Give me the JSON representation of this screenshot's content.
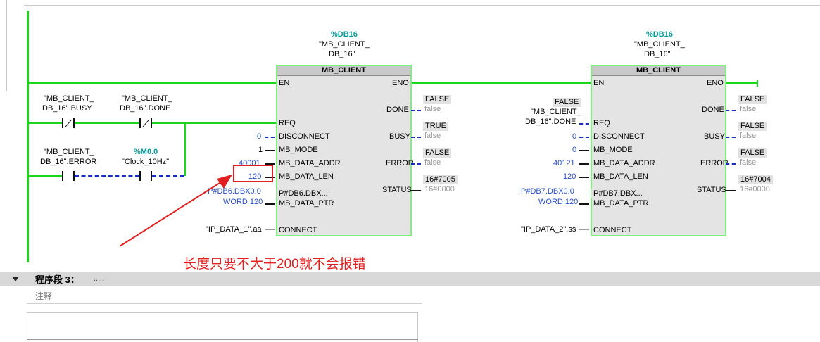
{
  "network": {
    "contacts": {
      "busy_tag": [
        "\"MB_CLIENT_",
        "DB_16\".BUSY"
      ],
      "done_tag": [
        "\"MB_CLIENT_",
        "DB_16\".DONE"
      ],
      "error_tag": [
        "\"MB_CLIENT_",
        "DB_16\".ERROR"
      ],
      "clock_addr": "%M0.0",
      "clock_tag": "\"Clock_10Hz\""
    },
    "block1": {
      "instance_addr": "%DB16",
      "instance_name": [
        "\"MB_CLIENT_",
        "DB_16\""
      ],
      "type": "MB_CLIENT",
      "inputs": {
        "en": "EN",
        "req": "REQ",
        "disconnect": "DISCONNECT",
        "mb_mode": "MB_MODE",
        "mb_data_addr": "MB_DATA_ADDR",
        "mb_data_len": "MB_DATA_LEN",
        "mb_data_ptr": "MB_DATA_PTR",
        "connect": "CONNECT"
      },
      "outputs": {
        "eno": "ENO",
        "done": "DONE",
        "busy": "BUSY",
        "error": "ERROR",
        "status": "STATUS"
      },
      "params": {
        "disconnect": "0",
        "mb_mode": "1",
        "mb_data_addr": "40001",
        "mb_data_len": "120",
        "ptr_line1": "P#DB6.DBX0.0",
        "ptr_line2": "WORD 120",
        "ptr_inner": "P#DB6.DBX...",
        "connect": "\"IP_DATA_1\".aa"
      },
      "out_values": {
        "done_box": "FALSE",
        "done_val": "false",
        "busy_box": "TRUE",
        "busy_val": "false",
        "error_box": "FALSE",
        "error_val": "false",
        "status_box": "16#7005",
        "status_val": "16#0000"
      }
    },
    "block2": {
      "instance_addr": "%DB16",
      "instance_name": [
        "\"MB_CLIENT_",
        "DB_16\""
      ],
      "type": "MB_CLIENT",
      "inputs": {
        "en": "EN",
        "req": "REQ",
        "disconnect": "DISCONNECT",
        "mb_mode": "MB_MODE",
        "mb_data_addr": "MB_DATA_ADDR",
        "mb_data_len": "MB_DATA_LEN",
        "mb_data_ptr": "MB_DATA_PTR",
        "connect": "CONNECT"
      },
      "outputs": {
        "eno": "ENO",
        "done": "DONE",
        "busy": "BUSY",
        "error": "ERROR",
        "status": "STATUS"
      },
      "req_box": "FALSE",
      "req_tag": [
        "\"MB_CLIENT_",
        "DB_16\".DONE"
      ],
      "params": {
        "disconnect": "0",
        "mb_mode": "0",
        "mb_data_addr": "40121",
        "mb_data_len": "120",
        "ptr_line1": "P#DB7.DBX0.0",
        "ptr_line2": "WORD 120",
        "ptr_inner": "P#DB7.DBX...",
        "connect": "\"IP_DATA_2\".ss"
      },
      "out_values": {
        "done_box": "FALSE",
        "done_val": "false",
        "busy_box": "FALSE",
        "busy_val": "false",
        "error_box": "FALSE",
        "error_val": "false",
        "status_box": "16#7004",
        "status_val": "16#0000"
      }
    },
    "annotation": "长度只要不大于200就不会报错"
  },
  "segment3": {
    "title": "程序段 3：",
    "dots": ".....",
    "comment": "注释"
  },
  "colors": {
    "power_rail": "#1ad51a",
    "block_border": "#7ef07e",
    "param_blue": "#2a4fc7",
    "annotation_red": "#e02020"
  }
}
